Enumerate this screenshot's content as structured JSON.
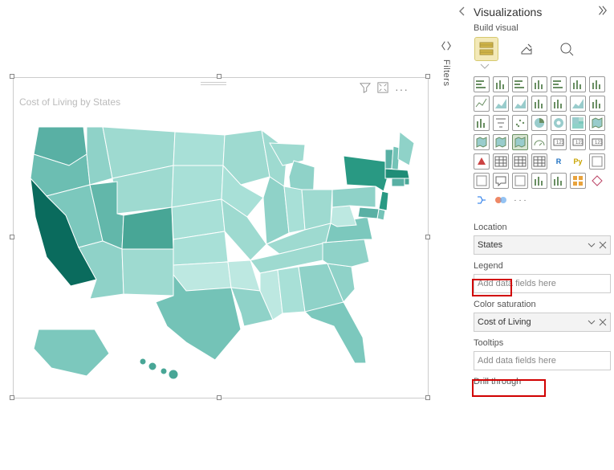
{
  "panel": {
    "title": "Visualizations",
    "subhead": "Build visual",
    "filters_label": "Filters"
  },
  "chart_types": [
    "stacked-bar",
    "stacked-col",
    "clustered-bar",
    "clustered-col",
    "percent-bar",
    "percent-col",
    "hund-col",
    "line",
    "area",
    "stacked-area",
    "line-col",
    "line-col-cl",
    "ribbon",
    "waterfall",
    "funnel",
    "scatter-small",
    "scatter",
    "pie",
    "donut",
    "treemap",
    "map-bubble",
    "map-filled",
    "map-shape",
    "filled-map",
    "gauge",
    "card",
    "multi-card",
    "kpi",
    "slicer",
    "table",
    "matrix",
    "r-visual",
    "R",
    "Py",
    "key-influencers",
    "decomposition",
    "qna",
    "narrative",
    "paginated",
    "metric",
    "app",
    "arcgis",
    "power-automate",
    "more-palette",
    "more"
  ],
  "chart_letters": {
    "r-visual": "R",
    "Py": "Py",
    "kpi-delta": "▲",
    "more": "· · ·"
  },
  "wells": {
    "location": {
      "label": "Location",
      "value": "States"
    },
    "legend": {
      "label": "Legend",
      "placeholder": "Add data fields here"
    },
    "saturation": {
      "label": "Color saturation",
      "value": "Cost of Living"
    },
    "tooltips": {
      "label": "Tooltips",
      "placeholder": "Add data fields here"
    },
    "drill": {
      "label": "Drill through"
    }
  },
  "visual": {
    "title": "Cost of Living by States"
  }
}
